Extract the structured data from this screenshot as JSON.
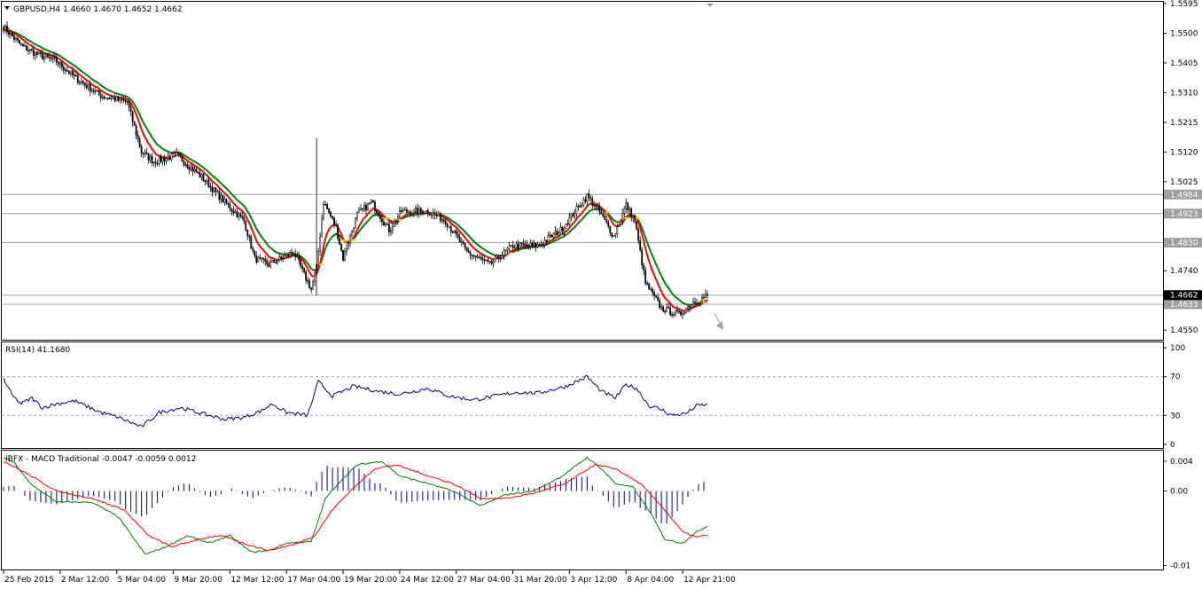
{
  "colors": {
    "background": "#ffffff",
    "candle": "#000000",
    "ma_red": "#ff0000",
    "ma_green": "#008000",
    "ma_yellow": "#ffd700",
    "rsi_line": "#000080",
    "macd_hist": "#000080",
    "macd_main": "#008000",
    "macd_signal": "#ff0000",
    "level_line": "#a0a0a0",
    "tag_bg": "#a0a0a0",
    "tag_text": "#ffffff"
  },
  "chart_data": [
    {
      "type": "candlestick",
      "title": "GBPUSD,H4  1.4660 1.4670 1.4652 1.4662",
      "ylim": [
        1.4525,
        1.5595
      ],
      "y_ticks": [
        "1.5595",
        "1.5500",
        "1.5405",
        "1.5310",
        "1.5215",
        "1.5120",
        "1.5025",
        "1.4740",
        "1.4550"
      ],
      "levels": [
        1.4984,
        1.4923,
        1.483,
        1.4633
      ],
      "level_labels": [
        "1.4984",
        "1.4923",
        "1.4830",
        "1.4633"
      ],
      "current_price": 1.4662,
      "current_label": "1.4662",
      "close_anchors": [
        [
          0,
          1.552
        ],
        [
          10,
          1.546
        ],
        [
          20,
          1.543
        ],
        [
          30,
          1.541
        ],
        [
          40,
          1.536
        ],
        [
          55,
          1.53
        ],
        [
          70,
          1.528
        ],
        [
          78,
          1.512
        ],
        [
          85,
          1.509
        ],
        [
          98,
          1.511
        ],
        [
          112,
          1.504
        ],
        [
          125,
          1.496
        ],
        [
          136,
          1.49
        ],
        [
          142,
          1.478
        ],
        [
          150,
          1.476
        ],
        [
          164,
          1.48
        ],
        [
          174,
          1.468
        ],
        [
          177,
          1.475
        ],
        [
          181,
          1.496
        ],
        [
          188,
          1.488
        ],
        [
          192,
          1.478
        ],
        [
          200,
          1.492
        ],
        [
          208,
          1.496
        ],
        [
          218,
          1.487
        ],
        [
          225,
          1.493
        ],
        [
          240,
          1.493
        ],
        [
          250,
          1.49
        ],
        [
          262,
          1.48
        ],
        [
          275,
          1.476
        ],
        [
          288,
          1.482
        ],
        [
          302,
          1.482
        ],
        [
          315,
          1.487
        ],
        [
          330,
          1.498
        ],
        [
          338,
          1.492
        ],
        [
          345,
          1.485
        ],
        [
          352,
          1.495
        ],
        [
          357,
          1.49
        ],
        [
          363,
          1.47
        ],
        [
          372,
          1.462
        ],
        [
          382,
          1.46
        ],
        [
          390,
          1.464
        ],
        [
          398,
          1.466
        ]
      ]
    },
    {
      "type": "line",
      "title": "RSI(14) 41.1680",
      "ylim": [
        0,
        100
      ],
      "y_ticks": [
        "100",
        "70",
        "30",
        "0"
      ],
      "levels": [
        70,
        30
      ],
      "anchors": [
        [
          0,
          68
        ],
        [
          5,
          50
        ],
        [
          10,
          42
        ],
        [
          16,
          48
        ],
        [
          22,
          38
        ],
        [
          30,
          42
        ],
        [
          40,
          45
        ],
        [
          55,
          33
        ],
        [
          65,
          28
        ],
        [
          78,
          18
        ],
        [
          88,
          33
        ],
        [
          100,
          38
        ],
        [
          112,
          32
        ],
        [
          125,
          26
        ],
        [
          136,
          28
        ],
        [
          146,
          35
        ],
        [
          152,
          42
        ],
        [
          160,
          33
        ],
        [
          172,
          30
        ],
        [
          178,
          65
        ],
        [
          186,
          50
        ],
        [
          198,
          60
        ],
        [
          212,
          55
        ],
        [
          224,
          52
        ],
        [
          240,
          58
        ],
        [
          252,
          50
        ],
        [
          266,
          46
        ],
        [
          278,
          50
        ],
        [
          290,
          54
        ],
        [
          302,
          53
        ],
        [
          318,
          60
        ],
        [
          330,
          70
        ],
        [
          338,
          55
        ],
        [
          346,
          48
        ],
        [
          352,
          62
        ],
        [
          358,
          58
        ],
        [
          365,
          40
        ],
        [
          372,
          36
        ],
        [
          378,
          30
        ],
        [
          386,
          32
        ],
        [
          392,
          40
        ],
        [
          398,
          41
        ]
      ]
    },
    {
      "type": "macd",
      "title": "IBFX - MACD Traditional -0.0047 -0.0059 0.0012",
      "ylim": [
        -0.0103,
        0.0047
      ],
      "y_ticks": [
        "0.004",
        "0.00",
        "-0.01"
      ],
      "main_anchors": [
        [
          0,
          0.0045
        ],
        [
          6,
          0.0038
        ],
        [
          15,
          0.001
        ],
        [
          30,
          -0.0015
        ],
        [
          50,
          -0.0015
        ],
        [
          65,
          -0.0035
        ],
        [
          80,
          -0.0085
        ],
        [
          92,
          -0.0075
        ],
        [
          104,
          -0.006
        ],
        [
          116,
          -0.007
        ],
        [
          128,
          -0.006
        ],
        [
          140,
          -0.0082
        ],
        [
          150,
          -0.008
        ],
        [
          160,
          -0.007
        ],
        [
          174,
          -0.0068
        ],
        [
          182,
          -0.001
        ],
        [
          190,
          0.0012
        ],
        [
          200,
          0.0035
        ],
        [
          214,
          0.004
        ],
        [
          224,
          0.002
        ],
        [
          240,
          0.001
        ],
        [
          254,
          0.0
        ],
        [
          270,
          -0.002
        ],
        [
          284,
          -0.0005
        ],
        [
          300,
          0.0
        ],
        [
          316,
          0.002
        ],
        [
          330,
          0.0045
        ],
        [
          338,
          0.003
        ],
        [
          346,
          0.001
        ],
        [
          356,
          0.0005
        ],
        [
          366,
          -0.003
        ],
        [
          374,
          -0.0065
        ],
        [
          384,
          -0.007
        ],
        [
          392,
          -0.0055
        ],
        [
          398,
          -0.0047
        ]
      ],
      "signal_anchors": [
        [
          0,
          0.004
        ],
        [
          12,
          0.0025
        ],
        [
          30,
          0.0
        ],
        [
          50,
          -0.001
        ],
        [
          68,
          -0.0025
        ],
        [
          82,
          -0.006
        ],
        [
          95,
          -0.0075
        ],
        [
          110,
          -0.0065
        ],
        [
          124,
          -0.006
        ],
        [
          138,
          -0.0072
        ],
        [
          150,
          -0.008
        ],
        [
          164,
          -0.0072
        ],
        [
          176,
          -0.006
        ],
        [
          186,
          -0.0025
        ],
        [
          196,
          0.0
        ],
        [
          210,
          0.003
        ],
        [
          222,
          0.0035
        ],
        [
          238,
          0.0022
        ],
        [
          254,
          0.001
        ],
        [
          270,
          -0.001
        ],
        [
          284,
          -0.001
        ],
        [
          300,
          -0.0003
        ],
        [
          318,
          0.001
        ],
        [
          334,
          0.0035
        ],
        [
          346,
          0.003
        ],
        [
          360,
          0.001
        ],
        [
          372,
          -0.002
        ],
        [
          384,
          -0.0055
        ],
        [
          392,
          -0.0062
        ],
        [
          398,
          -0.0059
        ]
      ]
    }
  ],
  "x_axis": {
    "labels": [
      "25 Feb 2015",
      "2 Mar 12:00",
      "5 Mar 04:00",
      "9 Mar 20:00",
      "12 Mar 12:00",
      "17 Mar 04:00",
      "19 Mar 20:00",
      "24 Mar 12:00",
      "27 Mar 04:00",
      "31 Mar 20:00",
      "3 Apr 12:00",
      "8 Apr 04:00",
      "12 Apr 21:00"
    ],
    "bar_positions": [
      0,
      32,
      64,
      96,
      128,
      160,
      192,
      224,
      256,
      288,
      320,
      352,
      384
    ]
  }
}
